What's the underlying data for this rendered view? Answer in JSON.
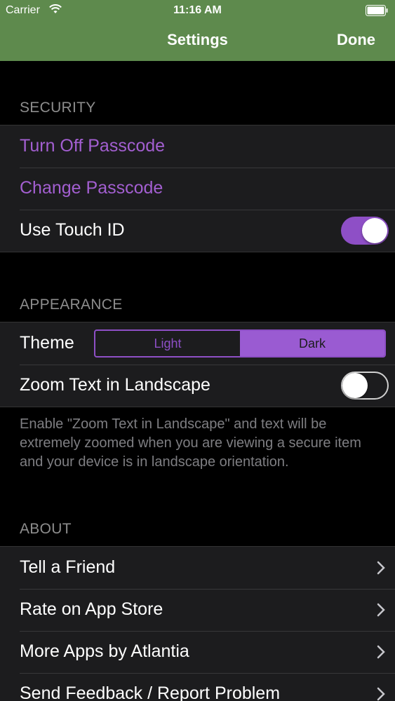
{
  "status_bar": {
    "carrier": "Carrier",
    "time": "11:16 AM"
  },
  "nav": {
    "title": "Settings",
    "done_label": "Done"
  },
  "security": {
    "header": "SECURITY",
    "turn_off_passcode": "Turn Off Passcode",
    "change_passcode": "Change Passcode",
    "use_touch_id": "Use Touch ID",
    "touch_id_enabled": true
  },
  "appearance": {
    "header": "APPEARANCE",
    "theme_label": "Theme",
    "theme_options": [
      "Light",
      "Dark"
    ],
    "theme_selected": "Dark",
    "zoom_text_label": "Zoom Text in Landscape",
    "zoom_text_enabled": false,
    "footer": "Enable \"Zoom Text in Landscape\" and text will be extremely zoomed when you are viewing a secure item and your device is in landscape orientation."
  },
  "about": {
    "header": "ABOUT",
    "items": [
      {
        "label": "Tell a Friend"
      },
      {
        "label": "Rate on App Store"
      },
      {
        "label": "More Apps by Atlantia"
      },
      {
        "label": "Send Feedback / Report Problem"
      }
    ]
  },
  "colors": {
    "nav_green": "#5e8a4d",
    "accent_purple": "#8e4fc6",
    "background": "#000000",
    "cell_background": "#1c1c1e"
  }
}
